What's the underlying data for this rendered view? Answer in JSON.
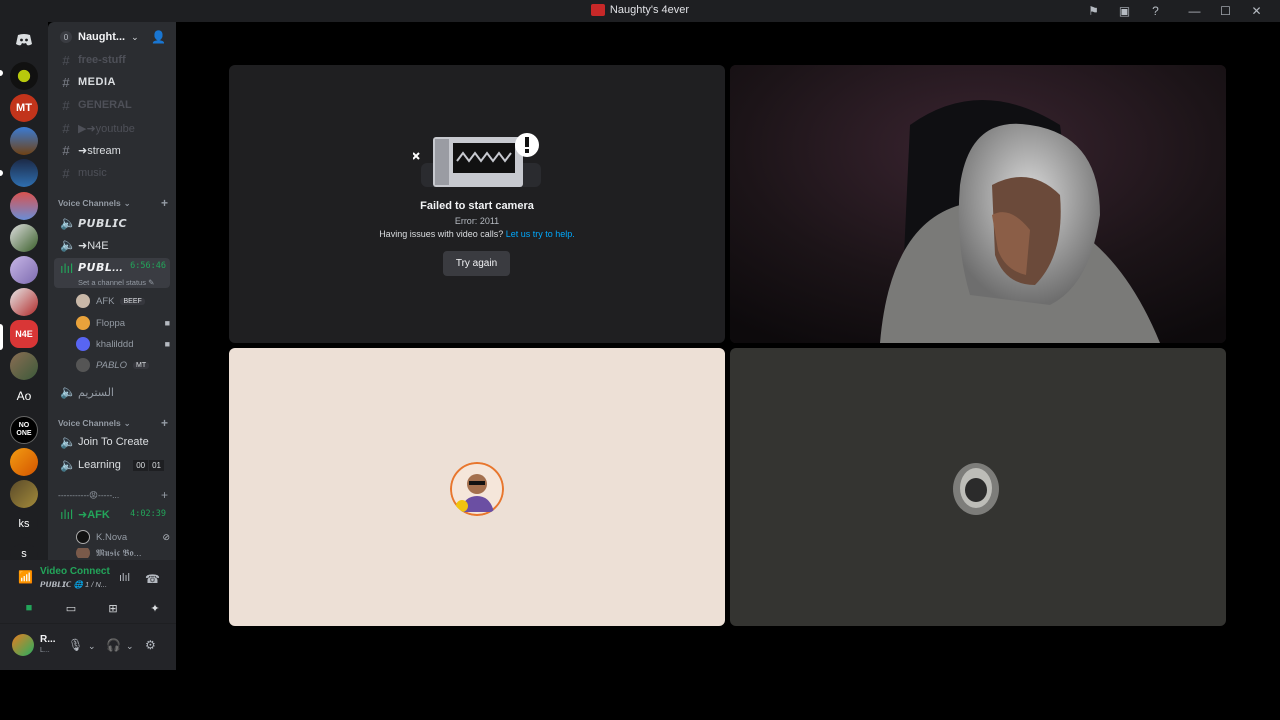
{
  "window": {
    "title": "Naughty's 4ever"
  },
  "titlebar_icons": [
    "flag-icon",
    "inbox-icon",
    "help-icon",
    "minimize-icon",
    "maximize-icon",
    "close-icon"
  ],
  "server_rail": {
    "items": [
      {
        "name": "home",
        "label": ""
      },
      {
        "name": "server-1",
        "label": ""
      },
      {
        "name": "server-mt",
        "label": "MT"
      },
      {
        "name": "server-3",
        "label": ""
      },
      {
        "name": "server-4",
        "label": ""
      },
      {
        "name": "server-5",
        "label": ""
      },
      {
        "name": "server-6",
        "label": ""
      },
      {
        "name": "server-7",
        "label": ""
      },
      {
        "name": "server-8",
        "label": ""
      },
      {
        "name": "server-n4e",
        "label": "N4E"
      },
      {
        "name": "server-10",
        "label": ""
      },
      {
        "name": "server-ao",
        "label": "Ao"
      },
      {
        "name": "server-noone",
        "label": "NO ONE"
      },
      {
        "name": "server-13",
        "label": ""
      },
      {
        "name": "server-14",
        "label": ""
      },
      {
        "name": "server-ks",
        "label": "ks"
      },
      {
        "name": "server-s",
        "label": "s"
      }
    ]
  },
  "guild": {
    "badge": "0",
    "name": "Naught...",
    "chevron": "⌄"
  },
  "channels": {
    "text": [
      {
        "name": "free-stuff",
        "icon": "#",
        "state": "muted"
      },
      {
        "name": "MEDIA",
        "icon": "#",
        "state": "normal"
      },
      {
        "name": "GENERAL",
        "icon": "#",
        "state": "muted"
      },
      {
        "name": "▶➜youtube",
        "icon": "#",
        "state": "muted"
      },
      {
        "name": "➜stream",
        "icon": "#",
        "state": "normal"
      },
      {
        "name": "music",
        "icon": "#",
        "state": "muted"
      }
    ],
    "voice_category_1": "Voice Channels",
    "voice": [
      {
        "name": "𝙋𝙐𝘽𝙇𝙄𝘾",
        "icon": "🔊"
      },
      {
        "name": "➜N4E",
        "icon": "🔊"
      }
    ],
    "active_voice": {
      "name": "𝙋𝙐𝘽𝙇...",
      "timer": "6:56:46",
      "status": "Set a channel status"
    },
    "voice_users": [
      {
        "name": "AFK",
        "tag": "BEEF",
        "cam": false
      },
      {
        "name": "Floppa",
        "tag": "",
        "cam": true
      },
      {
        "name": "khalilddd",
        "tag": "",
        "cam": true
      },
      {
        "name": "PABLO",
        "tag": "MT",
        "cam": false
      }
    ],
    "arabic_channel": "الستريم",
    "voice_category_2": "Voice Channels",
    "voice_2": [
      {
        "name": "Join To Create",
        "icon": "🔊"
      },
      {
        "name": "Learning",
        "icon": "🔊",
        "count_a": "00",
        "count_b": "01"
      }
    ],
    "divider_category": "-----------😡-----...",
    "afk_channel": {
      "name": "➜AFK",
      "timer": "4:02:39"
    },
    "afk_users": [
      {
        "name": "K.Nova"
      },
      {
        "name": "𝕸𝖚𝖘𝖎𝖈 𝕭𝖔..."
      }
    ]
  },
  "rtc": {
    "connection": "Video Connected",
    "channel": "𝙋𝙐𝘽𝙇𝙄𝘾 🌐 1 / N..."
  },
  "user": {
    "name": "R...",
    "status": "L..."
  },
  "tiles": {
    "error": {
      "title": "Failed to start camera",
      "code": "Error: 2011",
      "help_prefix": "Having issues with video calls?",
      "help_link": "Let us try to help.",
      "button": "Try again"
    }
  },
  "colors": {
    "accent_green": "#23a55a",
    "link_blue": "#00a8fc",
    "tile_light": "#ede0d6",
    "tile_dark": "#343431"
  }
}
